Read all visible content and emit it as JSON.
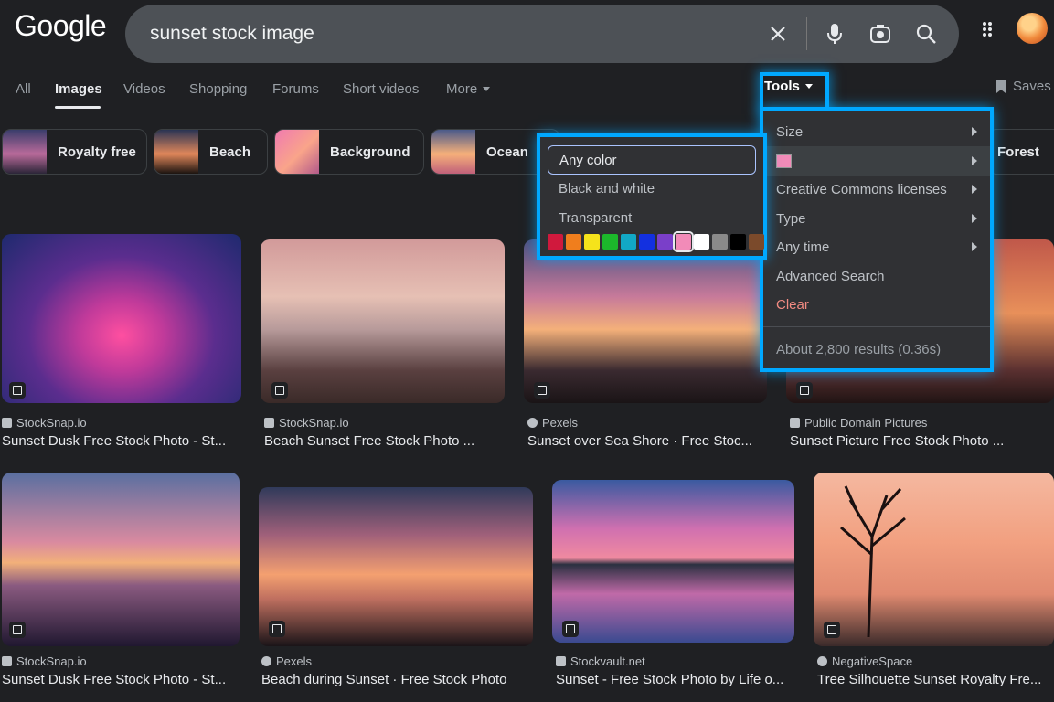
{
  "header": {
    "logo": "Google",
    "search_query": "sunset stock image",
    "icons": [
      "close-icon",
      "microphone-icon",
      "camera-icon",
      "search-icon",
      "apps-icon"
    ]
  },
  "tabs": [
    {
      "label": "All"
    },
    {
      "label": "Images",
      "active": true
    },
    {
      "label": "Videos"
    },
    {
      "label": "Shopping"
    },
    {
      "label": "Forums"
    },
    {
      "label": "Short videos"
    },
    {
      "label": "More"
    }
  ],
  "tools_label": "Tools",
  "saves_label": "Saves",
  "chips": [
    {
      "label": "Royalty free"
    },
    {
      "label": "Beach"
    },
    {
      "label": "Background"
    },
    {
      "label": "Ocean"
    },
    {
      "label": "Forest"
    }
  ],
  "tools_menu": {
    "items": [
      {
        "label": "Size"
      },
      {
        "label": ""
      },
      {
        "label": "Creative Commons licenses"
      },
      {
        "label": "Type"
      },
      {
        "label": "Any time"
      },
      {
        "label": "Advanced Search"
      },
      {
        "label": "Clear"
      }
    ],
    "result_stats": "About 2,800 results (0.36s)",
    "selected_color": "#f28bb8"
  },
  "color_menu": {
    "items": [
      {
        "label": "Any color"
      },
      {
        "label": "Black and white"
      },
      {
        "label": "Transparent"
      }
    ],
    "swatches": [
      "#d0193d",
      "#f07e1d",
      "#f5e31b",
      "#1cb82b",
      "#12a8c6",
      "#1330e0",
      "#7a3fc9",
      "#f28bb8",
      "#ffffff",
      "#8a8a8a",
      "#000000",
      "#7b4a2b"
    ]
  },
  "results": [
    {
      "source": "StockSnap.io",
      "title": "Sunset Dusk Free Stock Photo - St..."
    },
    {
      "source": "StockSnap.io",
      "title": "Beach Sunset Free Stock Photo ..."
    },
    {
      "source": "Pexels",
      "title": "Sunset over Sea Shore · Free Stoc..."
    },
    {
      "source": "Public Domain Pictures",
      "title": "Sunset Picture Free Stock Photo ..."
    },
    {
      "source": "StockSnap.io",
      "title": "Sunset Dusk Free Stock Photo - St..."
    },
    {
      "source": "Pexels",
      "title": "Beach during Sunset · Free Stock Photo"
    },
    {
      "source": "Stockvault.net",
      "title": "Sunset - Free Stock Photo by Life o..."
    },
    {
      "source": "NegativeSpace",
      "title": "Tree Silhouette Sunset Royalty Fre..."
    }
  ]
}
